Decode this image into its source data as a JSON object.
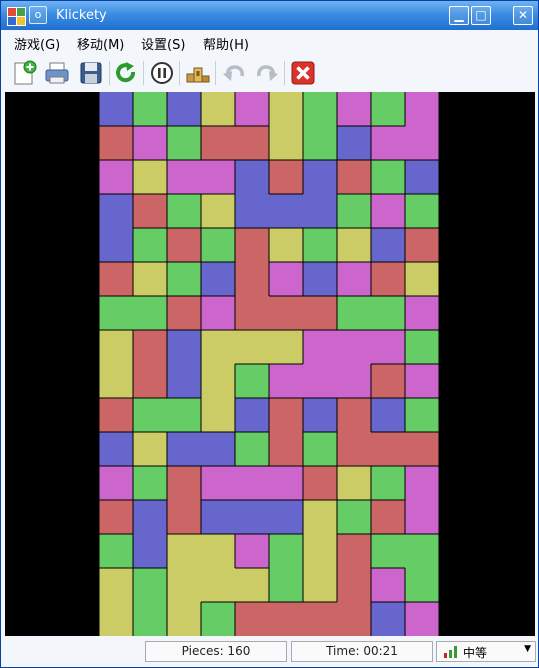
{
  "window": {
    "title": "Klickety"
  },
  "menus": [
    {
      "label": "游戏(G)"
    },
    {
      "label": "移动(M)"
    },
    {
      "label": "设置(S)"
    },
    {
      "label": "帮助(H)"
    }
  ],
  "toolbar": {
    "icons": [
      "new-game-icon",
      "print-icon",
      "save-icon",
      "restart-icon",
      "pause-icon",
      "highscores-icon",
      "undo-icon",
      "redo-icon",
      "quit-icon"
    ]
  },
  "colors": {
    "blue": "#6666cc",
    "green": "#66cc66",
    "yellow": "#cccc66",
    "magenta": "#cc66cc",
    "red": "#cc6666",
    "background": "#000000"
  },
  "board": {
    "columns": 10,
    "rows": 16,
    "grid": [
      "BGBYMYGMGM",
      "RMGRRYGBMM",
      "MYMMBRBRGB",
      "BRGYBBBGMG",
      "BGRGRYGYBR",
      "RYGBRMBMRY",
      "GGRMRRRGGM",
      "YRBYYYMMMG",
      "YRBYGMMMRM",
      "RGGYBRBRBG",
      "BYBBGRGRRR",
      "MGRMMMRYGM",
      "RBRBBBYGRM",
      "GBYYMGYRGG",
      "YGYYYGYRMG",
      "YGYGRRRRBM"
    ]
  },
  "status": {
    "pieces": "Pieces: 160",
    "time": "Time: 00:21",
    "difficulty": "中等"
  }
}
